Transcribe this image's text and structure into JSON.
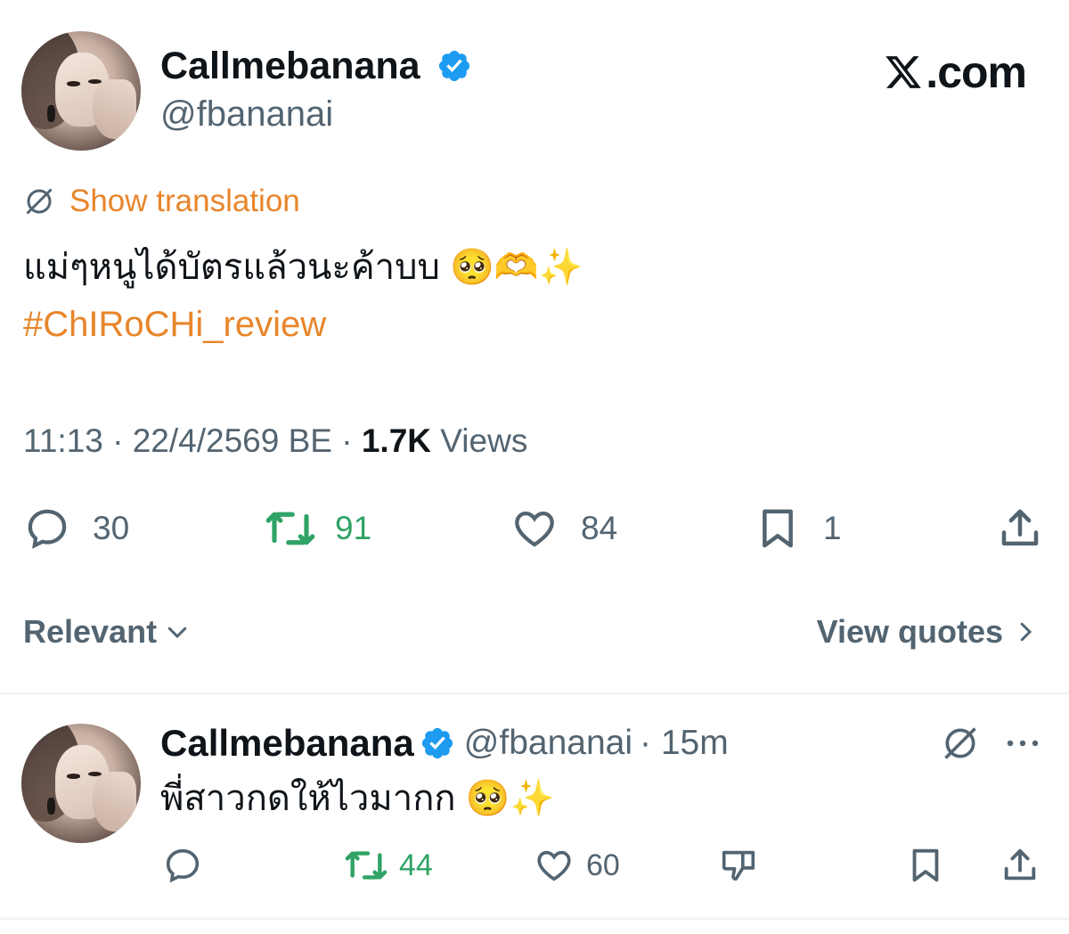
{
  "site_label": ".com",
  "main_tweet": {
    "author_name": "Callmebanana",
    "author_handle": "@fbananai",
    "show_translation": "Show translation",
    "text_line1": "แม่ๆหนูได้บัตรแล้วนะค้าบบ",
    "emojis": "🥺🫶✨",
    "hashtag": "#ChIRoCHi_review",
    "time": "11:13 · 22/4/2569 BE · ",
    "views_count": "1.7K",
    "views_label": " Views",
    "replies": "30",
    "reposts": "91",
    "likes": "84",
    "bookmarks": "1"
  },
  "sort": {
    "label": "Relevant",
    "view_quotes": "View quotes"
  },
  "reply": {
    "author_name": "Callmebanana",
    "author_handle": "@fbananai",
    "time": "· 15m",
    "text": "พี่สาวกดให้ไวมากก",
    "emojis": "🥺✨",
    "reposts": "44",
    "likes": "60"
  },
  "colors": {
    "accent_orange": "#e8852b",
    "verified_blue": "#1d9bf0",
    "repost_green": "#2fa365",
    "secondary_text": "#536471"
  }
}
